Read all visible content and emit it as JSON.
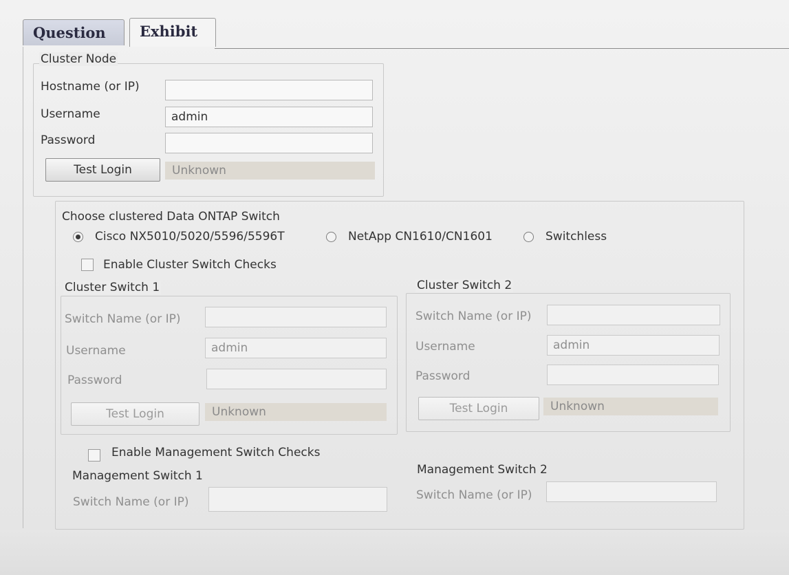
{
  "tabs": {
    "question": "Question",
    "exhibit": "Exhibit"
  },
  "cluster_node": {
    "legend": "Cluster Node",
    "hostname_label": "Hostname (or IP)",
    "hostname_value": "",
    "username_label": "Username",
    "username_value": "admin",
    "password_label": "Password",
    "password_value": "",
    "test_login_label": "Test Login",
    "status": "Unknown"
  },
  "switch_section": {
    "title": "Choose clustered Data ONTAP Switch",
    "options": [
      {
        "label": "Cisco NX5010/5020/5596/5596T",
        "selected": true
      },
      {
        "label": "NetApp CN1610/CN1601",
        "selected": false
      },
      {
        "label": "Switchless",
        "selected": false
      }
    ],
    "enable_cluster_checks_label": "Enable Cluster Switch Checks",
    "cluster_switch_1": {
      "legend": "Cluster Switch 1",
      "switch_name_label": "Switch Name (or IP)",
      "username_label": "Username",
      "username_value": "admin",
      "password_label": "Password",
      "test_login_label": "Test Login",
      "status": "Unknown"
    },
    "cluster_switch_2": {
      "legend": "Cluster Switch 2",
      "switch_name_label": "Switch Name (or IP)",
      "username_label": "Username",
      "username_value": "admin",
      "password_label": "Password",
      "test_login_label": "Test Login",
      "status": "Unknown"
    },
    "enable_mgmt_checks_label": "Enable Management Switch Checks",
    "management_switch_1": {
      "legend": "Management Switch 1",
      "switch_name_label": "Switch Name (or IP)"
    },
    "management_switch_2": {
      "legend": "Management Switch 2",
      "switch_name_label": "Switch Name (or IP)"
    }
  }
}
